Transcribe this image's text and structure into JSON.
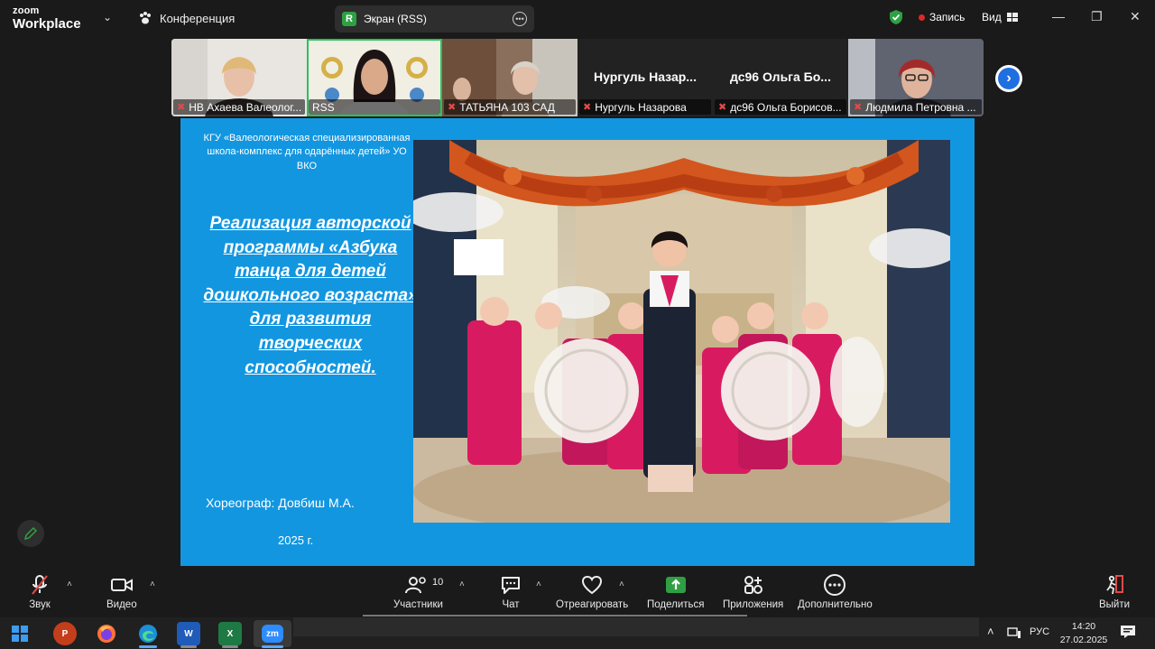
{
  "app": {
    "logo_line1": "zoom",
    "logo_line2": "Workplace",
    "conference_label": "Конференция",
    "share_pill_letter": "R",
    "share_label": "Экран (RSS)",
    "record_label": "Запись",
    "view_label": "Вид"
  },
  "participants": [
    {
      "caption": "НВ Ахаева Валеолог...",
      "muted": true
    },
    {
      "caption": "RSS",
      "muted": false,
      "active": true
    },
    {
      "caption": "ТАТЬЯНА 103 САД",
      "muted": true
    },
    {
      "display_name": "Нургуль Назар...",
      "caption": "Нургуль Назарова",
      "muted": true
    },
    {
      "display_name": "дс96 Ольга Бо...",
      "caption": "дс96 Ольга Борисов...",
      "muted": true
    },
    {
      "caption": "Людмила Петровна ...",
      "muted": true
    }
  ],
  "slide": {
    "org": "КГУ «Валеологическая специализированная школа-комплекс для одарённых детей» УО ВКО",
    "heading": "Реализация авторской программы «Азбука танца для детей дошкольного возраста» для развития творческих способностей.",
    "choreographer": "Хореограф: Довбиш М.А.",
    "year": "2025 г."
  },
  "toolbar": {
    "audio": "Звук",
    "video": "Видео",
    "participants": "Участники",
    "participants_count": "10",
    "chat": "Чат",
    "react": "Отреагировать",
    "share": "Поделиться",
    "apps": "Приложения",
    "more": "Дополнительно",
    "leave": "Выйти"
  },
  "taskbar": {
    "zoom_label": "zm",
    "word_label": "W",
    "excel_label": "X",
    "ppt_label": "P",
    "lang": "РУС",
    "time": "14:20",
    "date": "27.02.2025"
  },
  "colors": {
    "slide_bg": "#1396e0",
    "active_border": "#27c35a",
    "share_green": "#2ea043",
    "record_red": "#e02828"
  }
}
